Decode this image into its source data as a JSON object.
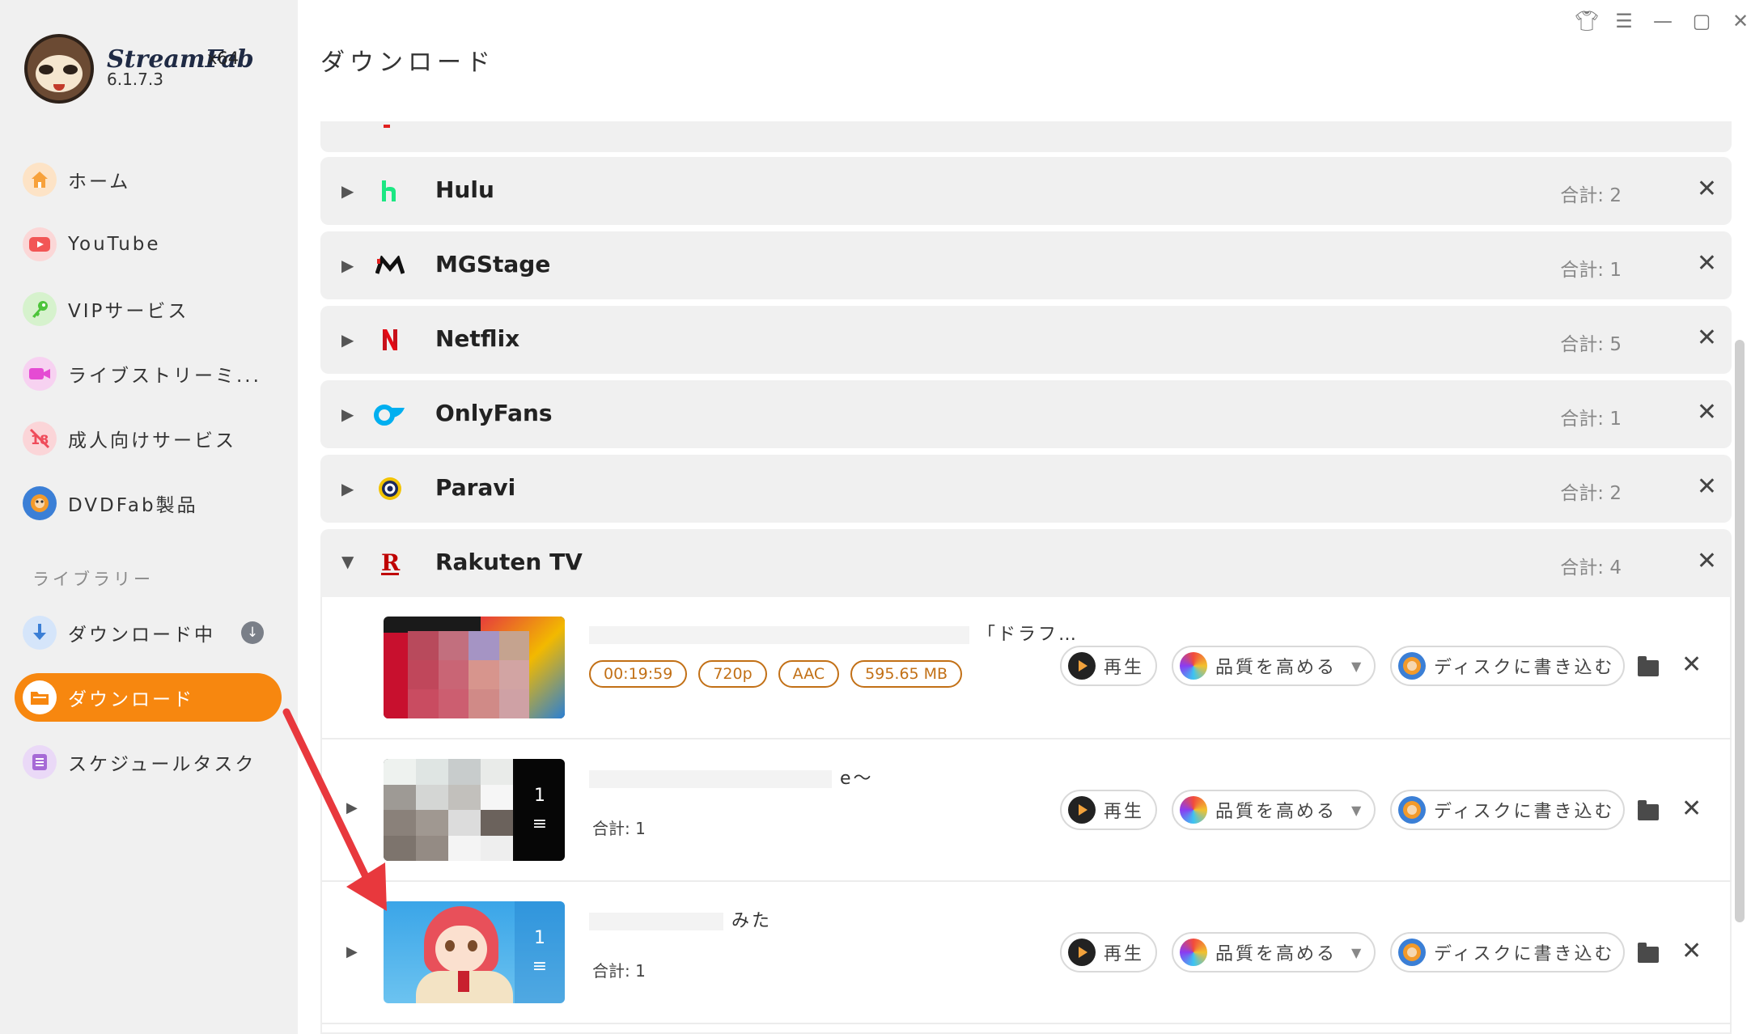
{
  "app": {
    "name": "StreamFab",
    "arch": "x64",
    "version": "6.1.7.3"
  },
  "window_controls": [
    "shirt-icon",
    "menu-icon",
    "minimize-icon",
    "maximize-icon",
    "close-icon"
  ],
  "sidebar": {
    "items": [
      {
        "label": "ホーム",
        "icon": "home-icon",
        "color": "#f7a13b"
      },
      {
        "label": "YouTube",
        "icon": "youtube-icon",
        "color": "#f25555"
      },
      {
        "label": "VIPサービス",
        "icon": "key-icon",
        "color": "#4cc43a"
      },
      {
        "label": "ライブストリーミ...",
        "icon": "camera-icon",
        "color": "#e54bd3"
      },
      {
        "label": "成人向けサービス",
        "icon": "adult-icon",
        "color": "#ef4b5a"
      },
      {
        "label": "DVDFab製品",
        "icon": "dvdfab-icon",
        "color": "#3b7fd6"
      }
    ],
    "library_heading": "ライブラリー",
    "library": [
      {
        "label": "ダウンロード中",
        "icon": "download-icon",
        "color": "#3b7fd6",
        "badge": "↓"
      },
      {
        "label": "ダウンロード",
        "icon": "folder-icon",
        "color": "#f7870f",
        "active": true
      },
      {
        "label": "スケジュールタスク",
        "icon": "schedule-icon",
        "color": "#a66ad6"
      }
    ]
  },
  "page_title": "ダウンロード",
  "groups": [
    {
      "name": "Hulu",
      "count": "合計: 2",
      "logo": "hulu-logo",
      "expanded": false
    },
    {
      "name": "MGStage",
      "count": "合計: 1",
      "logo": "mgstage-logo",
      "expanded": false
    },
    {
      "name": "Netflix",
      "count": "合計: 5",
      "logo": "netflix-logo",
      "expanded": false
    },
    {
      "name": "OnlyFans",
      "count": "合計: 1",
      "logo": "onlyfans-logo",
      "expanded": false
    },
    {
      "name": "Paravi",
      "count": "合計: 2",
      "logo": "paravi-logo",
      "expanded": false
    },
    {
      "name": "Rakuten TV",
      "count": "合計: 4",
      "logo": "rakuten-logo",
      "expanded": true
    }
  ],
  "items": [
    {
      "title": "「ドラフ…",
      "tags": [
        "00:19:59",
        "720p",
        "AAC",
        "595.65 MB"
      ]
    },
    {
      "title": "e〜",
      "count": "合計: 1",
      "playlist_count": "1"
    },
    {
      "title": "みた",
      "count": "合計: 1",
      "playlist_count": "1"
    }
  ],
  "actions": {
    "play": "再生",
    "enhance": "品質を高める",
    "burn": "ディスクに書き込む"
  },
  "colors": {
    "accent": "#f7870f",
    "tag_border": "#c27016",
    "arrow": "#e8383d"
  }
}
